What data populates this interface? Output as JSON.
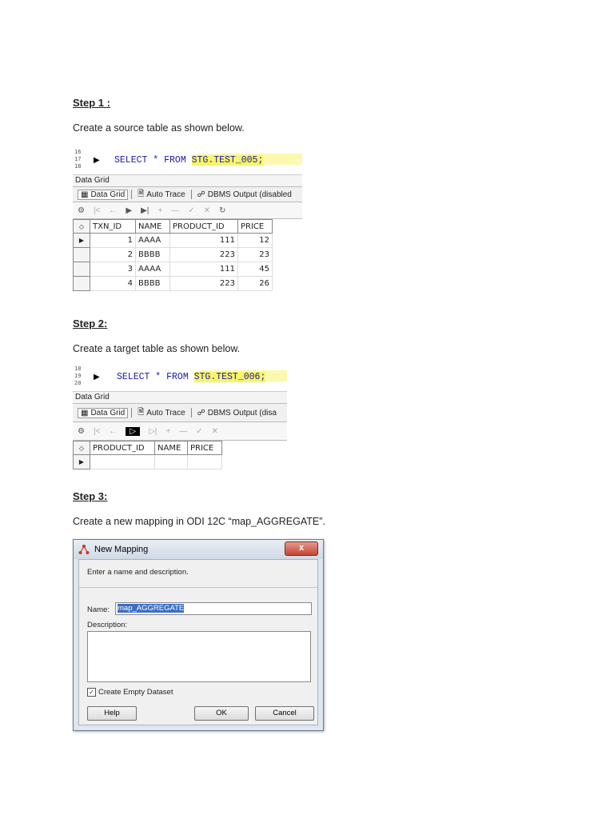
{
  "step1": {
    "heading": "Step 1 :",
    "text": "Create a source table as shown below.",
    "line_numbers": [
      "16",
      "17",
      "18"
    ],
    "sql": "SELECT * FROM ",
    "sql_highlight": "STG.TEST_005;",
    "panel_title": "Data Grid",
    "tabs": [
      "Data Grid",
      "Auto Trace",
      "DBMS Output (disabled"
    ],
    "columns": [
      "TXN_ID",
      "NAME",
      "PRODUCT_ID",
      "PRICE"
    ],
    "rows": [
      [
        "1",
        "AAAA",
        "111",
        "12"
      ],
      [
        "2",
        "BBBB",
        "223",
        "23"
      ],
      [
        "3",
        "AAAA",
        "111",
        "45"
      ],
      [
        "4",
        "BBBB",
        "223",
        "26"
      ]
    ]
  },
  "step2": {
    "heading": "Step 2:",
    "text": "Create a target table as shown below.",
    "line_numbers": [
      "18",
      "19",
      "20"
    ],
    "sql": "SELECT * FROM ",
    "sql_highlight": "STG.TEST_006;",
    "panel_title": "Data Grid",
    "tabs": [
      "Data Grid",
      "Auto Trace",
      "DBMS Output (disa"
    ],
    "columns": [
      "PRODUCT_ID",
      "NAME",
      "PRICE"
    ]
  },
  "step3": {
    "heading": "Step 3:",
    "text": "Create a new mapping in ODI 12C “map_AGGREGATE”."
  },
  "dialog": {
    "title": "New Mapping",
    "close_label": "x",
    "description_hint": "Enter a name and description.",
    "name_label": "Name:",
    "name_value": "map_AGGREGATE",
    "description_label": "Description:",
    "checkbox_label": "Create Empty Dataset",
    "help_label": "Help",
    "ok_label": "OK",
    "cancel_label": "Cancel"
  }
}
